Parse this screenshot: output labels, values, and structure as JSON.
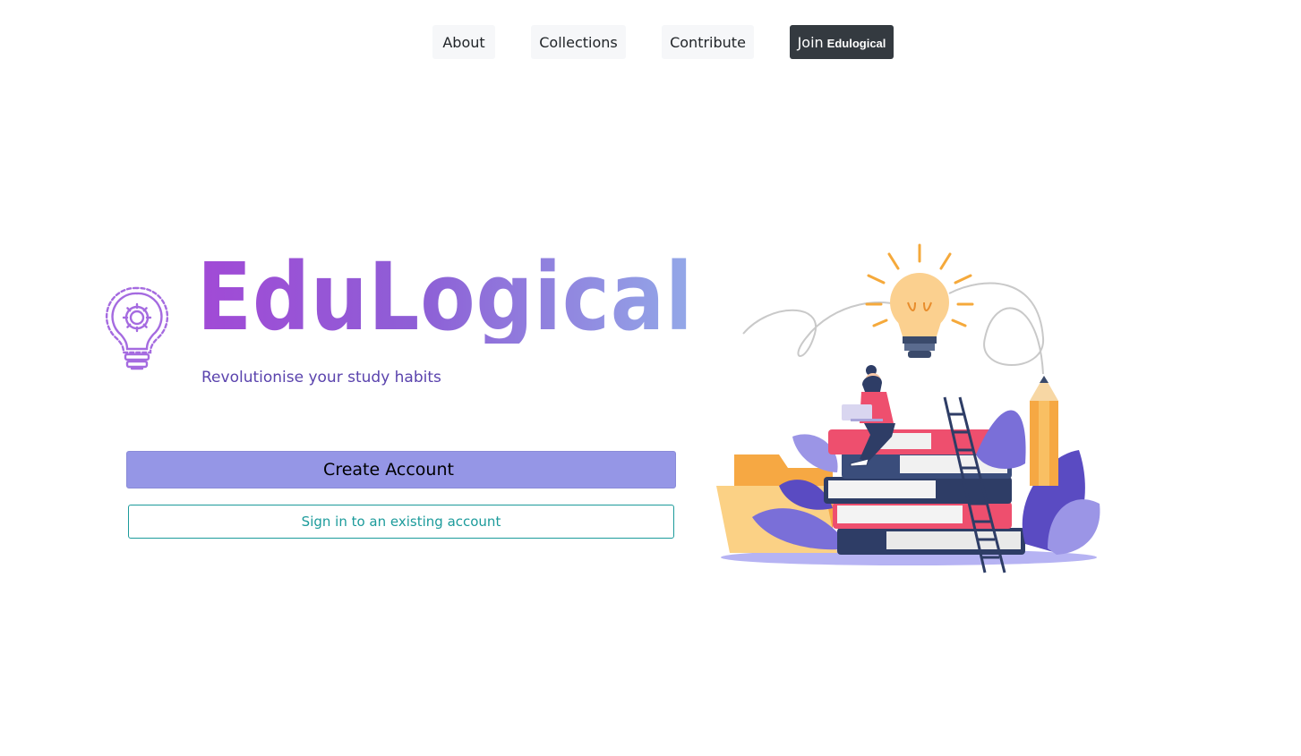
{
  "nav": {
    "about": "About",
    "collections": "Collections",
    "contribute": "Contribute",
    "join_prefix": "Join",
    "join_brand": "Edulogical"
  },
  "hero": {
    "brand": "EduLogical",
    "tagline": "Revolutionise your study habits",
    "create_account_label": "Create Account",
    "sign_in_label": "Sign in to an existing account"
  },
  "icons": {
    "logo": "lightbulb-gear-icon",
    "illustration": "study-books-lightbulb-illustration"
  },
  "colors": {
    "brand_gradient_start": "#a14ad6",
    "brand_gradient_end": "#93a9e8",
    "tagline": "#5a43ad",
    "create_button": "#9596e6",
    "sign_in_accent": "#1c9b9b",
    "join_button": "#343a40"
  }
}
